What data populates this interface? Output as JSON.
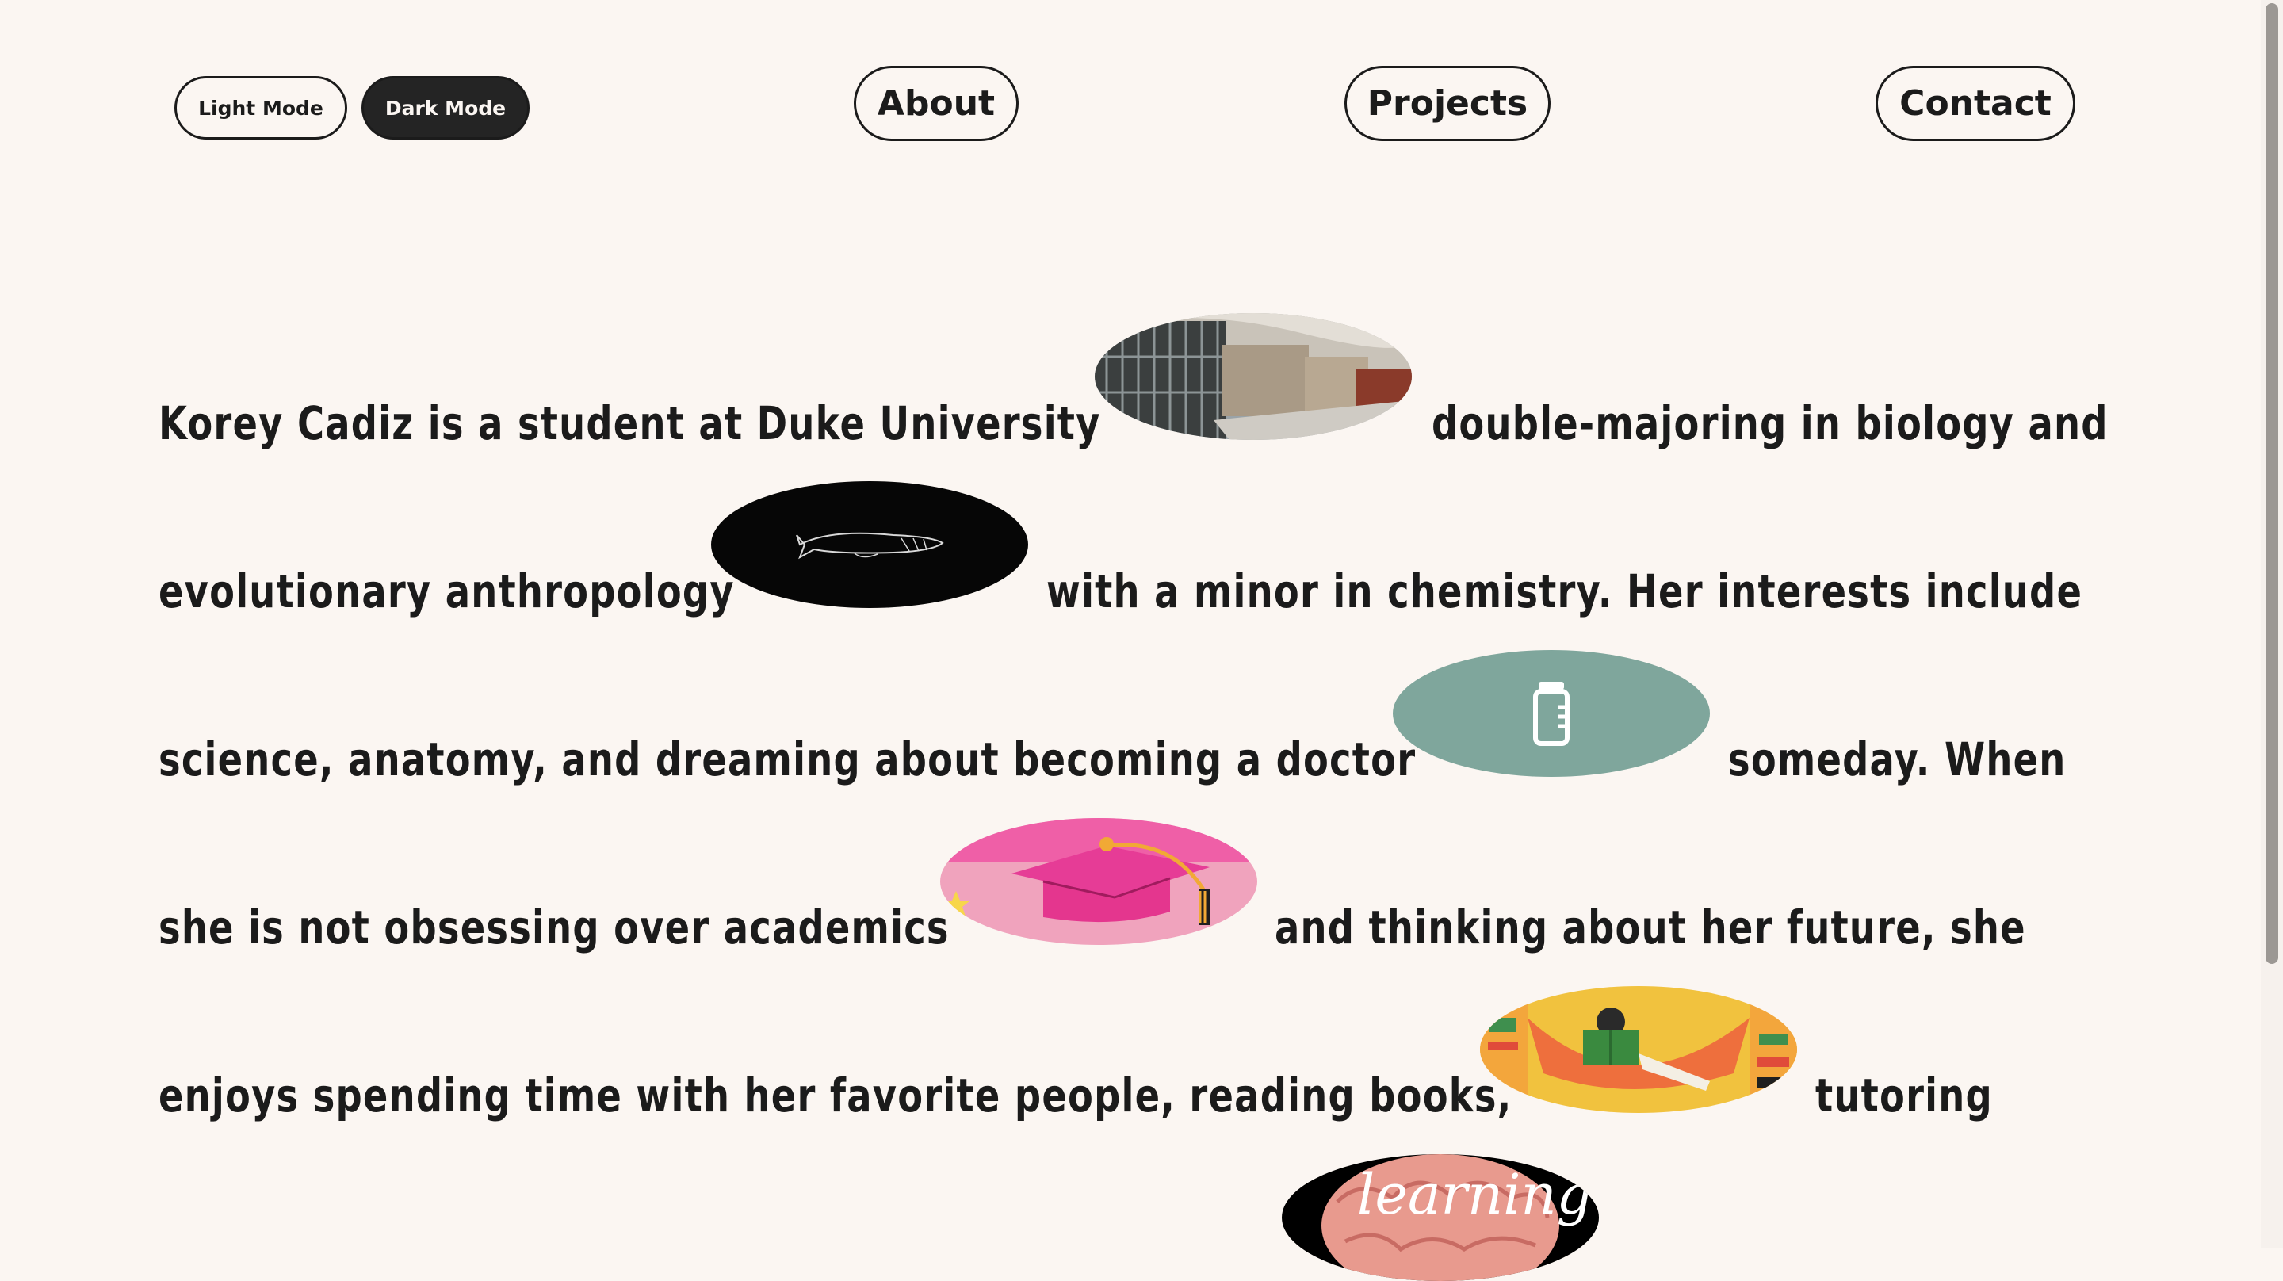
{
  "mode_toggle": {
    "light_label": "Light Mode",
    "dark_label": "Dark Mode"
  },
  "nav": {
    "about": "About",
    "projects": "Projects",
    "contact": "Contact"
  },
  "bio": {
    "line1_a": "Korey Cadiz is a student at Duke University",
    "line1_b": "double-majoring in biology and",
    "line2_a": "evolutionary anthropology",
    "line2_b": "with a minor in chemistry. Her interests include",
    "line3_a": "science, anatomy, and dreaming about becoming a doctor",
    "line3_b": "someday. When",
    "line4_a": "she is not obsessing over academics",
    "line4_b": "and thinking about her future, she",
    "line5_a": "enjoys spending time with her favorite people, reading books,",
    "line5_b": "tutoring",
    "learning_text": "learning"
  },
  "icons": [
    "campus-photo",
    "fish-skeleton-icon",
    "vial-icon",
    "graduation-cap-icon",
    "reading-hammock-illustration",
    "brain-learning-icon"
  ],
  "colors": {
    "background": "#fbf6f2",
    "text": "#1b1b1b",
    "sage": "#7fa69c",
    "pink": "#f0a3bd",
    "mustard": "#f1c23e"
  }
}
